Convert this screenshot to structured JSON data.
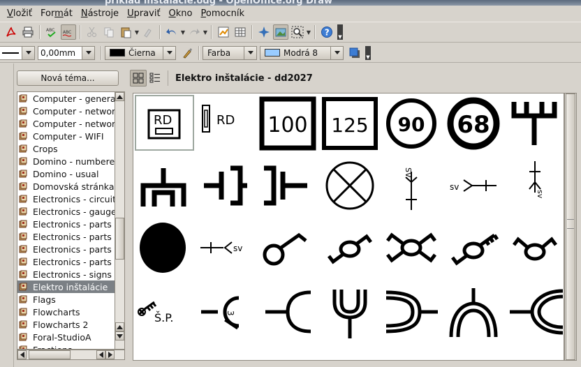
{
  "window": {
    "title": "príklad inštalácie.odg - OpenOffice.org Draw"
  },
  "menu": [
    {
      "label": "Vložiť",
      "u": "V"
    },
    {
      "label": "Formát",
      "u": "m"
    },
    {
      "label": "Nástroje",
      "u": "N"
    },
    {
      "label": "Upraviť",
      "u": "U"
    },
    {
      "label": "Okno",
      "u": "O"
    },
    {
      "label": "Pomocník",
      "u": "P"
    }
  ],
  "format_bar": {
    "line_width": "0,00mm",
    "line_color": "Čierna",
    "line_color_hex": "#000000",
    "area_style": "Farba",
    "area_color": "Modrá 8",
    "area_color_hex": "#99ccff"
  },
  "gallery": {
    "new_theme_label": "Nová téma...",
    "themes": [
      "Computer - general",
      "Computer - network",
      "Computer - network",
      "Computer - WIFI",
      "Crops",
      "Domino - numbered",
      "Domino - usual",
      "Domovská stránka",
      "Electronics - circuits",
      "Electronics - gauges",
      "Electronics - parts",
      "Electronics - parts",
      "Electronics - parts",
      "Electronics - parts",
      "Electronics - signs",
      "Elektro inštalácie",
      "Flags",
      "Flowcharts",
      "Flowcharts 2",
      "Foral-StudioA",
      "Fractions"
    ],
    "selected_theme_index": 15,
    "view_title": "Elektro inštalácie - dd2027",
    "symbols": [
      {
        "name": "rd-box-symbol",
        "text": "RD"
      },
      {
        "name": "rd-fuse-symbol",
        "text": "RD"
      },
      {
        "name": "square-100-symbol",
        "text": "100"
      },
      {
        "name": "square-125-symbol",
        "text": "125"
      },
      {
        "name": "circle-90-symbol",
        "text": "90"
      },
      {
        "name": "circle-68-symbol",
        "text": "68"
      },
      {
        "name": "fork-symbol",
        "text": ""
      },
      {
        "name": "plug-socket-symbol",
        "text": ""
      },
      {
        "name": "capacitor-left-symbol",
        "text": ""
      },
      {
        "name": "capacitor-right-symbol",
        "text": ""
      },
      {
        "name": "lamp-x-symbol",
        "text": ""
      },
      {
        "name": "sv-vertical-symbol",
        "text": "SV"
      },
      {
        "name": "sv-horizontal-symbol",
        "text": "SV"
      },
      {
        "name": "sv-vertical-2-symbol",
        "text": "SV"
      },
      {
        "name": "filled-circle-symbol",
        "text": ""
      },
      {
        "name": "sv-right-symbol",
        "text": "SV"
      },
      {
        "name": "switch-1-symbol",
        "text": ""
      },
      {
        "name": "switch-2-symbol",
        "text": ""
      },
      {
        "name": "switch-cross-symbol",
        "text": ""
      },
      {
        "name": "switch-3-symbol",
        "text": ""
      },
      {
        "name": "switch-4-symbol",
        "text": ""
      },
      {
        "name": "sp-key-symbol",
        "text": "Š.P."
      },
      {
        "name": "socket-3-symbol",
        "text": "3"
      },
      {
        "name": "arc-left-symbol",
        "text": ""
      },
      {
        "name": "y-fork-symbol",
        "text": ""
      },
      {
        "name": "arc-right-double-symbol",
        "text": ""
      },
      {
        "name": "arch-symbol",
        "text": ""
      },
      {
        "name": "double-arc-left-symbol",
        "text": ""
      }
    ]
  }
}
